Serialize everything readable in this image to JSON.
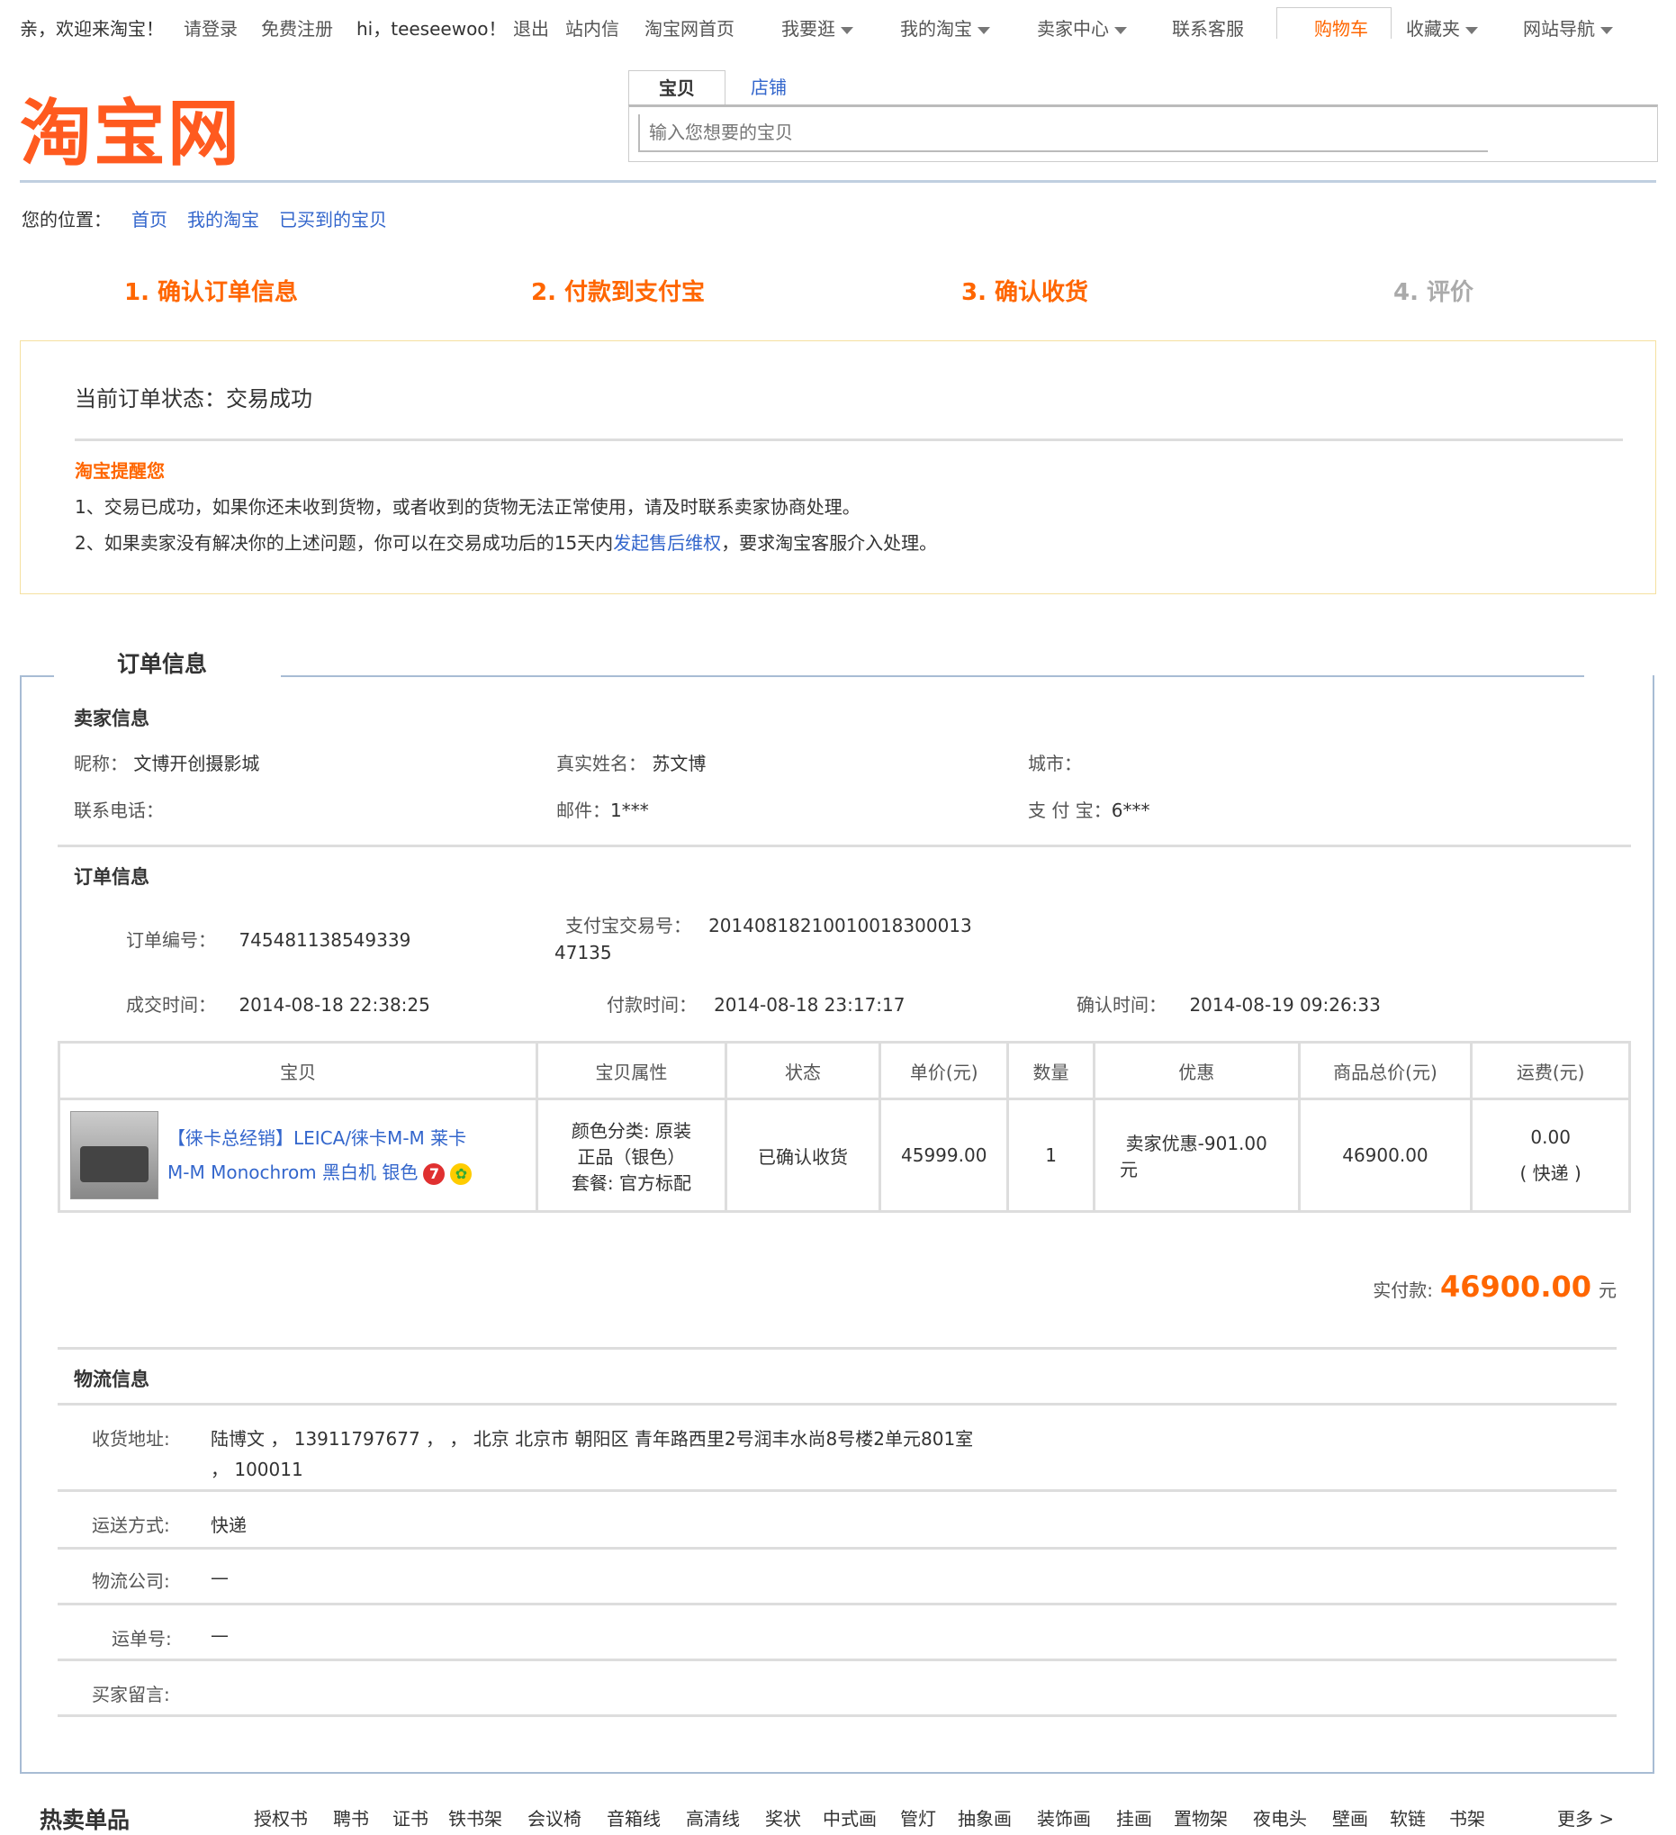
{
  "topbar": {
    "greeting": "亲，欢迎来淘宝！",
    "login": "请登录",
    "register": "免费注册",
    "user": "hi，teeseewoo！",
    "logout": "退出",
    "messages": "站内信",
    "home": "淘宝网首页",
    "browse": "我要逛",
    "my_taobao": "我的淘宝",
    "seller_center": "卖家中心",
    "service": "联系客服",
    "cart": "购物车",
    "favorites": "收藏夹",
    "site_nav": "网站导航"
  },
  "logo": "淘宝网",
  "search": {
    "tab_item": "宝贝",
    "tab_shop": "店铺",
    "placeholder": "输入您想要的宝贝"
  },
  "breadcrumb": {
    "label": "您的位置：",
    "items": [
      "首页",
      "我的淘宝",
      "已买到的宝贝"
    ]
  },
  "steps": [
    {
      "label": "1. 确认订单信息",
      "active": true
    },
    {
      "label": "2. 付款到支付宝",
      "active": true
    },
    {
      "label": "3. 确认收货",
      "active": true
    },
    {
      "label": "4. 评价",
      "active": false
    }
  ],
  "status": {
    "title": "当前订单状态：交易成功",
    "reminder_title": "淘宝提醒您",
    "line1": "1、交易已成功，如果你还未收到货物，或者收到的货物无法正常使用，请及时联系卖家协商处理。",
    "line2_pre": "2、如果卖家没有解决你的上述问题，你可以在交易成功后的15天内",
    "line2_link": "发起售后维权",
    "line2_post": "，要求淘宝客服介入处理。"
  },
  "order_info": {
    "title": "订单信息",
    "seller": {
      "title": "卖家信息",
      "nickname_label": "昵称：",
      "nickname": "文博开创摄影城",
      "realname_label": "真实姓名：",
      "realname": "苏文博",
      "city_label": "城市：",
      "city": "",
      "phone_label": "联系电话：",
      "phone": "",
      "email_label": "邮件：",
      "email": "1***",
      "alipay_label": "支 付 宝：",
      "alipay": "6***"
    },
    "order": {
      "title": "订单信息",
      "order_no_label": "订单编号：",
      "order_no": "745481138549339",
      "alipay_no_label": "支付宝交易号：",
      "alipay_no_1": "20140818210010018300013",
      "alipay_no_2": "47135",
      "deal_time_label": "成交时间：",
      "deal_time": "2014-08-18 22:38:25",
      "pay_time_label": "付款时间：",
      "pay_time": "2014-08-18 23:17:17",
      "confirm_time_label": "确认时间：",
      "confirm_time": "2014-08-19 09:26:33"
    },
    "table": {
      "headers": [
        "宝贝",
        "宝贝属性",
        "状态",
        "单价(元)",
        "数量",
        "优惠",
        "商品总价(元)",
        "运费(元)"
      ],
      "row": {
        "title_1": "【徕卡总经销】LEICA/徕卡M-M 莱卡",
        "title_2": "M-M Monochrom 黑白机 银色",
        "attr_1": "颜色分类: 原装",
        "attr_2": "正品（银色）",
        "attr_3": "套餐: 官方标配",
        "status": "已确认收货",
        "price": "45999.00",
        "qty": "1",
        "discount_1": "卖家优惠-901.00",
        "discount_2": "元",
        "total": "46900.00",
        "shipping_1": "0.00",
        "shipping_2": "( 快递 )"
      }
    },
    "paid_label": "实付款:",
    "paid_amount": "46900.00",
    "paid_unit": "元"
  },
  "logistics": {
    "title": "物流信息",
    "address_label": "收货地址:",
    "address_1": "陆博文 ， 13911797677 ， ， 北京 北京市 朝阳区 青年路西里2号润丰水尚8号楼2单元801室",
    "address_2": "， 100011",
    "method_label": "运送方式:",
    "method": "快递",
    "company_label": "物流公司:",
    "company": "—",
    "tracking_label": "运单号:",
    "tracking": "—",
    "message_label": "买家留言:",
    "message": ""
  },
  "hot": {
    "title": "热卖单品",
    "items": [
      "授权书",
      "聘书",
      "证书",
      "铁书架",
      "会议椅",
      "音箱线",
      "高清线",
      "奖状",
      "中式画",
      "管灯",
      "抽象画",
      "装饰画",
      "挂画",
      "置物架",
      "夜电头",
      "壁画",
      "软链",
      "书架"
    ],
    "more": "更多 >"
  },
  "colors": {
    "accent": "#ff6600",
    "link": "#3366cc",
    "frame": "#a8bcd4"
  }
}
